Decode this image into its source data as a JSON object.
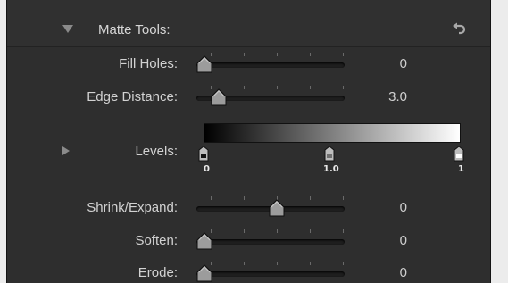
{
  "section": {
    "title": "Matte Tools:"
  },
  "rows": [
    {
      "label": "Fill Holes:",
      "value": "0",
      "position": 0.0
    },
    {
      "label": "Edge Distance:",
      "value": "3.0",
      "position": 0.1
    },
    {
      "label": "Shrink/Expand:",
      "value": "0",
      "position": 0.5
    },
    {
      "label": "Soften:",
      "value": "0",
      "position": 0.0
    },
    {
      "label": "Erode:",
      "value": "0",
      "position": 0.0
    }
  ],
  "levels": {
    "label": "Levels:",
    "black_label": "0",
    "gamma_label": "1.0",
    "white_label": "1"
  },
  "colors": {
    "panel_background": "#2e2e2e",
    "text": "#d2d2d2",
    "gradient_start": "#000000",
    "gradient_end": "#ffffff"
  }
}
